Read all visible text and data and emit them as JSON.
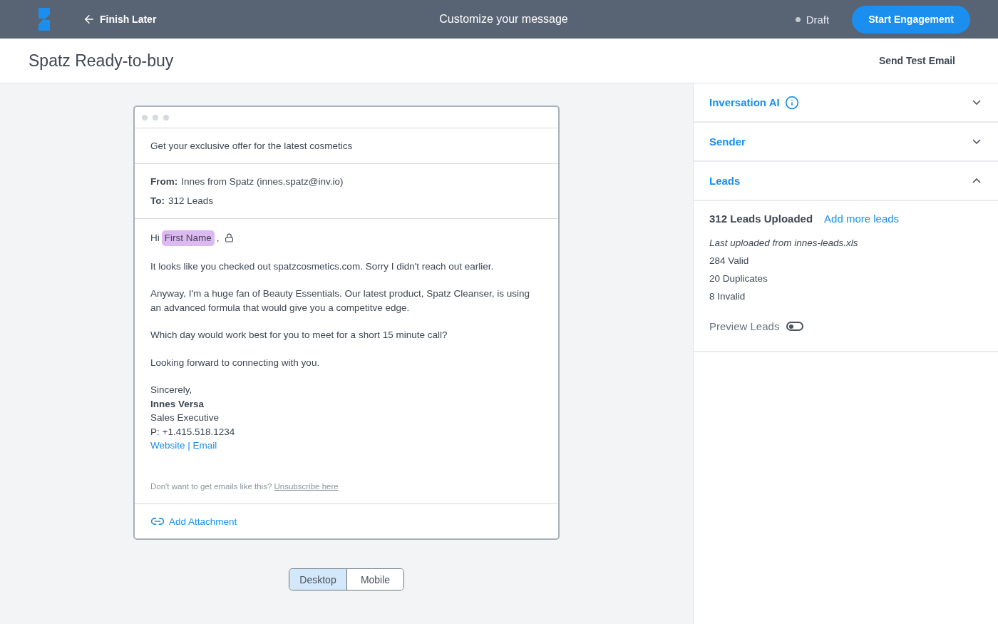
{
  "topbar": {
    "back_label": "Finish Later",
    "title": "Customize your message",
    "status": "Draft",
    "primary_button": "Start Engagement"
  },
  "page": {
    "title": "Spatz Ready-to-buy",
    "action": "Send Test Email"
  },
  "email": {
    "subject": "Get your exclusive offer for the latest cosmetics",
    "from_label": "From:",
    "from_value": "Innes from Spatz (innes.spatz@inv.io)",
    "to_label": "To:",
    "to_value": "312 Leads",
    "greeting": "Hi",
    "merge_field": "First Name",
    "greeting_end": ",",
    "paragraphs": [
      "It looks like you checked out spatzcosmetics.com. Sorry I didn't reach out earlier.",
      "Anyway, I'm a huge fan of Beauty Essentials. Our latest product, Spatz Cleanser, is using an advanced formula that would give you a competitve edge.",
      "Which day would work best for you to meet for a short 15 minute call?",
      "Looking forward to connecting with you."
    ],
    "closing": "Sincerely,",
    "signer": "Innes Versa",
    "role": "Sales Executive",
    "phone": "P: +1.415.518.1234",
    "links": [
      "Website",
      "Email"
    ],
    "link_separator": "|",
    "footer_text": "Don't want to get emails like this?",
    "unsubscribe": "Unsubscribe here",
    "attachment": "Add Attachment"
  },
  "view_toggle": [
    {
      "label": "Desktop",
      "selected": true
    },
    {
      "label": "Mobile",
      "selected": false
    }
  ],
  "sections": [
    {
      "title": "Inversation AI",
      "info": true,
      "expanded": false
    },
    {
      "title": "Sender",
      "info": false,
      "expanded": false
    },
    {
      "title": "Leads",
      "info": false,
      "expanded": true
    }
  ],
  "leads": {
    "count": "312 Leads Uploaded",
    "add_link": "Add more leads",
    "source": "Last uploaded from innes-leads.xls",
    "stats": [
      "284 Valid",
      "20 Duplicates",
      "8 Invalid"
    ],
    "preview_label": "Preview Leads",
    "preview_on": false
  }
}
